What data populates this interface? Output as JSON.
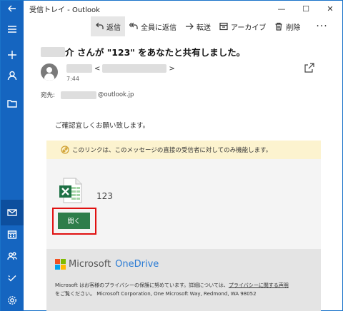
{
  "window": {
    "title": "受信トレイ - Outlook",
    "controls": [
      "—",
      "☐",
      "✕"
    ]
  },
  "rail": {
    "items": [
      "back",
      "menu",
      "new-mail",
      "people",
      "folder",
      "mail",
      "calendar",
      "contacts",
      "todo",
      "settings"
    ]
  },
  "toolbar": {
    "reply": "返信",
    "reply_all": "全員に返信",
    "forward": "転送",
    "archive": "アーカイブ",
    "delete": "削除",
    "more": "···"
  },
  "message": {
    "subject_suffix": "介 さんが \"123\" をあなたと共有しました。",
    "sender_open": "<",
    "sender_close": ">",
    "time": "7:44",
    "to_label": "宛先:",
    "to_domain": "@outlook.jp",
    "greeting": "ご確認宜しくお願い致します。"
  },
  "card": {
    "notice": "このリンクは、このメッセージの直接の受信者に対してのみ機能します。",
    "file_name": "123",
    "open_label": "開く",
    "brand_ms": "Microsoft",
    "brand_od": "OneDrive",
    "privacy_text": "Microsoft はお客様のプライバシーの保護に努めています。詳細については、",
    "privacy_link": "プライバシーに関する声明",
    "privacy_line2": "をご覧ください。 Microsoft Corporation, One Microsoft Way, Redmond, WA 98052"
  },
  "colors": {
    "rail": "#1565c0",
    "excel_green": "#2e7d4a",
    "notice_bg": "#fcf3cf",
    "highlight": "#e01010",
    "onedrive_blue": "#2a7bd4"
  }
}
